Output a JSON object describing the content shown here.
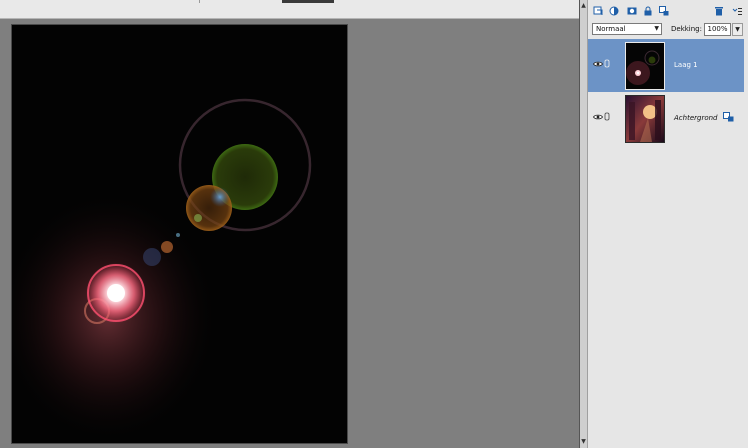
{
  "layers_panel": {
    "blend_mode": "Normaal",
    "opacity_label": "Dekking:",
    "opacity_value": "100%",
    "toolbar_icons": [
      "new-layer-icon",
      "adjustment-layer-icon",
      "layer-mask-icon",
      "lock-icon",
      "lock-all-icon",
      "delete-layer-icon",
      "panel-menu-icon"
    ],
    "layers": [
      {
        "name": "Laag 1",
        "selected": true
      },
      {
        "name": "Achtergrond",
        "selected": false
      }
    ]
  },
  "colors": {
    "panel_bg": "#e6e6e6",
    "selected_row": "#6c93c6",
    "workspace_bg": "#7f7f7f",
    "canvas_bg": "#030303",
    "icon_blue": "#1f5fa8"
  }
}
